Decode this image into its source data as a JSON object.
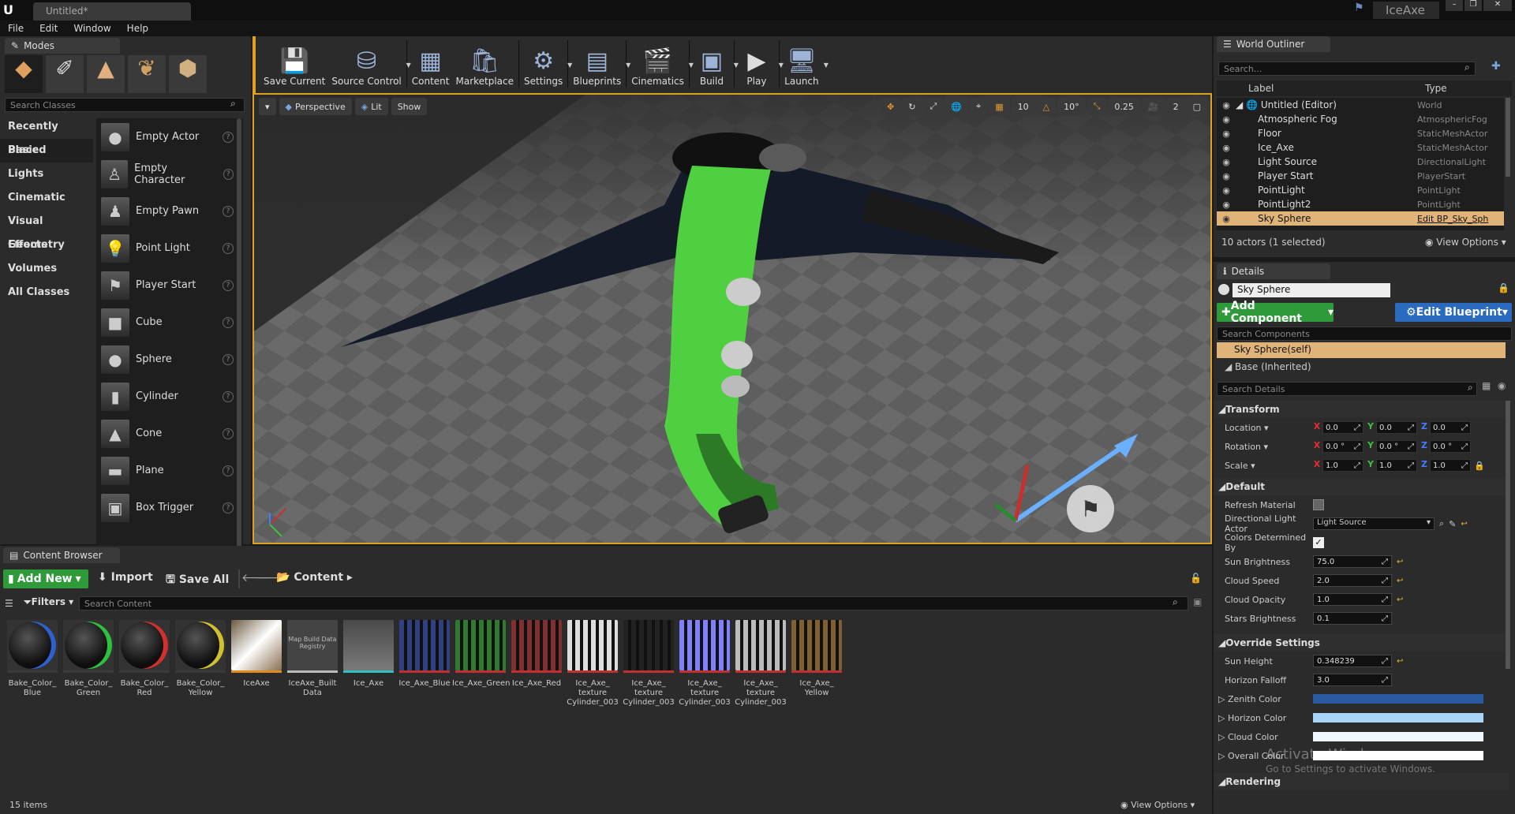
{
  "titlebar": {
    "tab": "Untitled*",
    "project": "IceAxe"
  },
  "menu": [
    "File",
    "Edit",
    "Window",
    "Help"
  ],
  "modes": {
    "tab": "Modes",
    "search_placeholder": "Search Classes",
    "categories": [
      "Recently Placed",
      "Basic",
      "Lights",
      "Cinematic",
      "Visual Effects",
      "Geometry",
      "Volumes",
      "All Classes"
    ],
    "selected_category": "Basic",
    "items": [
      "Empty Actor",
      "Empty Character",
      "Empty Pawn",
      "Point Light",
      "Player Start",
      "Cube",
      "Sphere",
      "Cylinder",
      "Cone",
      "Plane",
      "Box Trigger"
    ]
  },
  "toolbar": [
    {
      "label": "Save Current",
      "icon": "save-icon"
    },
    {
      "label": "Source Control",
      "icon": "source-control-icon"
    },
    {
      "label": "Content",
      "icon": "content-icon"
    },
    {
      "label": "Marketplace",
      "icon": "marketplace-icon"
    },
    {
      "label": "Settings",
      "icon": "settings-icon"
    },
    {
      "label": "Blueprints",
      "icon": "blueprints-icon"
    },
    {
      "label": "Cinematics",
      "icon": "cinematics-icon"
    },
    {
      "label": "Build",
      "icon": "build-icon"
    },
    {
      "label": "Play",
      "icon": "play-icon"
    },
    {
      "label": "Launch",
      "icon": "launch-icon"
    }
  ],
  "viewport": {
    "perspective": "Perspective",
    "lit": "Lit",
    "show": "Show",
    "grid_snap": "10",
    "rot_snap": "10°",
    "scale_snap": "0.25",
    "cam_speed": "2"
  },
  "outliner": {
    "tab": "World Outliner",
    "search_placeholder": "Search...",
    "col_label": "Label",
    "col_type": "Type",
    "rows": [
      {
        "label": "Untitled (Editor)",
        "type": "World"
      },
      {
        "label": "Atmospheric Fog",
        "type": "AtmosphericFog"
      },
      {
        "label": "Floor",
        "type": "StaticMeshActor"
      },
      {
        "label": "Ice_Axe",
        "type": "StaticMeshActor"
      },
      {
        "label": "Light Source",
        "type": "DirectionalLight"
      },
      {
        "label": "Player Start",
        "type": "PlayerStart"
      },
      {
        "label": "PointLight",
        "type": "PointLight"
      },
      {
        "label": "PointLight2",
        "type": "PointLight"
      },
      {
        "label": "Sky Sphere",
        "type": "Edit BP_Sky_Sph"
      }
    ],
    "status": "10 actors (1 selected)",
    "view_options": "View Options"
  },
  "details": {
    "tab": "Details",
    "name": "Sky Sphere",
    "add_component": "Add Component",
    "edit_blueprint": "Edit Blueprint",
    "search_components": "Search Components",
    "self": "Sky Sphere(self)",
    "base": "Base (Inherited)",
    "search_details": "Search Details",
    "transform": "Transform",
    "location_label": "Location",
    "rotation_label": "Rotation",
    "scale_label": "Scale",
    "location": [
      "0.0",
      "0.0",
      "0.0"
    ],
    "rotation": [
      "0.0 °",
      "0.0 °",
      "0.0 °"
    ],
    "scale": [
      "1.0",
      "1.0",
      "1.0"
    ],
    "default": "Default",
    "refresh_material": "Refresh Material",
    "dir_light_actor": "Directional Light Actor",
    "dir_light_value": "Light Source",
    "colors_determined": "Colors Determined By",
    "sun_brightness_label": "Sun Brightness",
    "sun_brightness": "75.0",
    "cloud_speed_label": "Cloud Speed",
    "cloud_speed": "2.0",
    "cloud_opacity_label": "Cloud Opacity",
    "cloud_opacity": "1.0",
    "stars_brightness_label": "Stars Brightness",
    "stars_brightness": "0.1",
    "override": "Override Settings",
    "sun_height_label": "Sun Height",
    "sun_height": "0.348239",
    "horizon_falloff_label": "Horizon Falloff",
    "horizon_falloff": "3.0",
    "zenith_label": "Zenith Color",
    "horizon_color_label": "Horizon Color",
    "cloud_color_label": "Cloud Color",
    "overall_color_label": "Overall Color",
    "rendering": "Rendering",
    "watermark1": "Activate Windows",
    "watermark2": "Go to Settings to activate Windows.",
    "zenith_color": "#2c5aa0",
    "horizon_color": "#a9d4f5"
  },
  "content_browser": {
    "tab": "Content Browser",
    "add_new": "Add New",
    "import": "Import",
    "save_all": "Save All",
    "path": "Content",
    "filters": "Filters",
    "search_placeholder": "Search Content",
    "item_count": "15 items",
    "view_options": "View Options",
    "assets": [
      {
        "name": "Bake_Color_ Blue",
        "bar": "#3a3a3a",
        "kind": "sphere",
        "tint": "#3060d0"
      },
      {
        "name": "Bake_Color_ Green",
        "bar": "#3a3a3a",
        "kind": "sphere",
        "tint": "#30c040"
      },
      {
        "name": "Bake_Color_ Red",
        "bar": "#3a3a3a",
        "kind": "sphere",
        "tint": "#d03030"
      },
      {
        "name": "Bake_Color_ Yellow",
        "bar": "#3a3a3a",
        "kind": "sphere",
        "tint": "#d0c030"
      },
      {
        "name": "IceAxe",
        "bar": "#e08a20",
        "kind": "level",
        "tint": "#8a7040"
      },
      {
        "name": "IceAxe_Built Data",
        "bar": "#bbbbbb",
        "kind": "registry",
        "tint": "#444",
        "thumb_text": "Map Build Data Registry"
      },
      {
        "name": "Ice_Axe",
        "bar": "#30c0c0",
        "kind": "mesh",
        "tint": "#7a8a8a"
      },
      {
        "name": "Ice_Axe_Blue",
        "bar": "#c03030",
        "kind": "tex",
        "tint": "#304080"
      },
      {
        "name": "Ice_Axe_Green",
        "bar": "#c03030",
        "kind": "tex",
        "tint": "#307a30"
      },
      {
        "name": "Ice_Axe_Red",
        "bar": "#c03030",
        "kind": "tex",
        "tint": "#803030"
      },
      {
        "name": "Ice_Axe_ texture Cylinder_003",
        "bar": "#c03030",
        "kind": "tex",
        "tint": "#dddddd"
      },
      {
        "name": "Ice_Axe_ texture Cylinder_003",
        "bar": "#c03030",
        "kind": "tex",
        "tint": "#222222"
      },
      {
        "name": "Ice_Axe_ texture Cylinder_003",
        "bar": "#c03030",
        "kind": "tex",
        "tint": "#8080ff"
      },
      {
        "name": "Ice_Axe_ texture Cylinder_003",
        "bar": "#c03030",
        "kind": "tex",
        "tint": "#bbbbbb"
      },
      {
        "name": "Ice_Axe_ Yellow",
        "bar": "#c03030",
        "kind": "tex",
        "tint": "#806030"
      }
    ]
  }
}
